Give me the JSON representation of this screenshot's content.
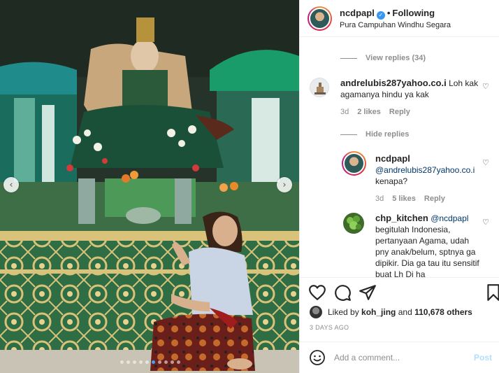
{
  "post": {
    "username": "ncdpapl",
    "follow_separator": "•",
    "follow_status": "Following",
    "location": "Pura Campuhan Windhu Segara",
    "verified_glyph": "✓"
  },
  "media": {
    "prev_glyph": "‹",
    "next_glyph": "›",
    "carousel_total": 10,
    "carousel_active": 5
  },
  "comments": {
    "view_replies": "View replies (34)",
    "hide_replies": "Hide replies",
    "items": [
      {
        "username": "andrelubis287yahoo.co.i",
        "text": "Loh kak agamanya hindu ya kak",
        "time": "3d",
        "likes": "2 likes",
        "reply": "Reply"
      },
      {
        "username": "ncdpapl",
        "mention": "@andrelubis287yahoo.co.i",
        "text": "kenapa?",
        "time": "3d",
        "likes": "5 likes",
        "reply": "Reply"
      },
      {
        "username": "chp_kitchen",
        "mention": "@ncdpapl",
        "text": "begitulah Indonesia, pertanyaan Agama, udah pny anak/belum, sptnya ga dipikir. Dia ga tau itu sensitif buat Lh Di ha"
      }
    ],
    "heart_glyph": "♡"
  },
  "actions": {
    "liked_prefix": "Liked by",
    "liked_user": "koh_jing",
    "liked_and": "and",
    "liked_count": "110,678 others",
    "timestamp": "3 DAYS AGO"
  },
  "add_comment": {
    "placeholder": "Add a comment...",
    "post_label": "Post"
  },
  "colors": {
    "link": "#00376b",
    "muted": "#8e8e8e",
    "post_disabled": "#b2dffc",
    "verified": "#3897f0"
  }
}
